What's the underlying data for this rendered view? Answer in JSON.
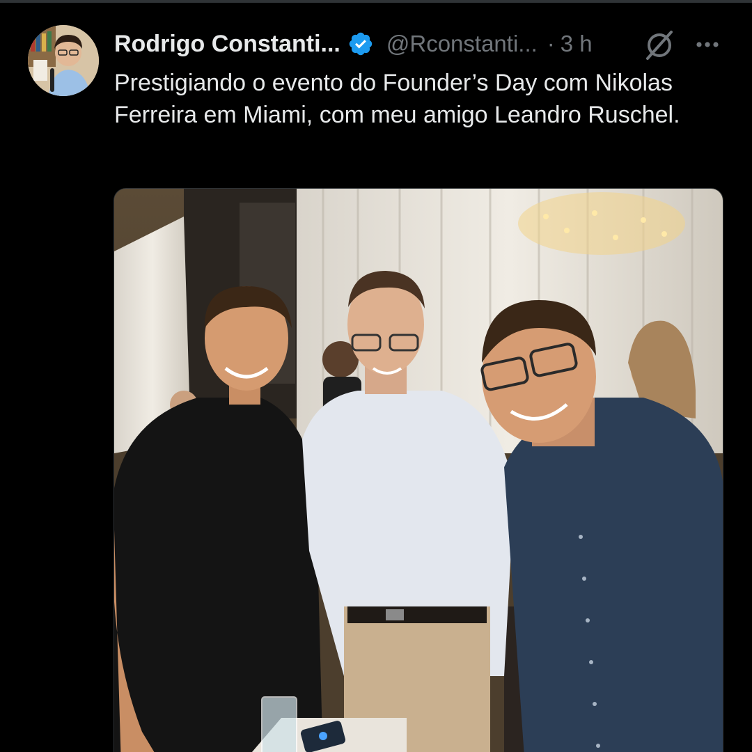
{
  "tweet": {
    "author": {
      "display_name": "Rodrigo Constanti...",
      "handle": "@Rconstanti...",
      "verified": true,
      "avatar_icon": "user-avatar"
    },
    "separator": "·",
    "timestamp": "3 h",
    "text": "Prestigiando o evento do Founder’s Day com Nikolas Ferreira em Miami, com meu amigo Leandro Ruschel.",
    "actions": {
      "grok_icon": "grok-icon",
      "more_icon": "more-options-icon"
    },
    "media": {
      "type": "photo"
    }
  },
  "colors": {
    "background": "#000000",
    "primary_text": "#e7e9ea",
    "secondary_text": "#71767b",
    "verified_blue": "#1d9bf0",
    "divider": "#2f3336"
  }
}
